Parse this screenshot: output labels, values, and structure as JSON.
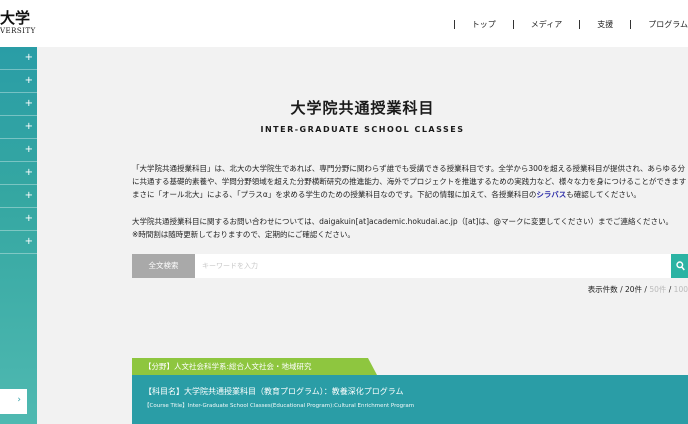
{
  "header": {
    "logo_main": "大学",
    "logo_sub": "VERSITY",
    "nav": [
      "トップ",
      "メディア",
      "支援",
      "プログラム"
    ]
  },
  "sidebar": {
    "items": [
      "+",
      "+",
      "+",
      "+",
      "+",
      "+",
      "+",
      "+",
      "+"
    ],
    "bottom_arrow": "›"
  },
  "page": {
    "title": "大学院共通授業科目",
    "subtitle": "INTER-GRADUATE SCHOOL CLASSES",
    "intro_line1": "「大学院共通授業科目」は、北大の大学院生であれば、専門分野に関わらず誰でも受講できる授業科目です。全学から300を超える授業科目が提供され、あらゆる分",
    "intro_line2": "に共通する基礎的素養や、学問分野領域を超えた分野横断研究の推進能力、海外でプロジェクトを推進するための実践力など、様々な力を身につけることができます",
    "intro_line3a": "まさに「オール北大」による、「プラスα」を求める学生のための授業科目なのです。下記の情報に加えて、各授業科目の",
    "intro_line3_link": "シラバス",
    "intro_line3b": "も確認してください。",
    "contact_line1": "大学院共通授業科目に関するお問い合わせについては、daigakuin[at]academic.hokudai.ac.jp（[at]は、@マークに変更してください）までご連絡ください。",
    "contact_line2": "※時間割は随時更新しておりますので、定期的にご確認ください。"
  },
  "search": {
    "label": "全文検索",
    "placeholder": "キーワードを入力",
    "value": ""
  },
  "results": {
    "prefix": "表示件数 / ",
    "opt1": "20件",
    "sep1": " / ",
    "opt2": "50件",
    "sep2": " / ",
    "opt3": "100"
  },
  "course": {
    "category": "【分野】人文社会科学系:総合人文社会・地域研究",
    "name": "【科目名】大学院共通授業科目（教育プログラム）：教養深化プログラム",
    "name_en": "【Course Title】Inter-Graduate School Classes(Educational Program):Cultural Enrichment Program"
  },
  "colors": {
    "teal": "#2a9da6",
    "green": "#8ec63f",
    "search_button": "#2bb3a3",
    "link": "#2a2aa6"
  }
}
